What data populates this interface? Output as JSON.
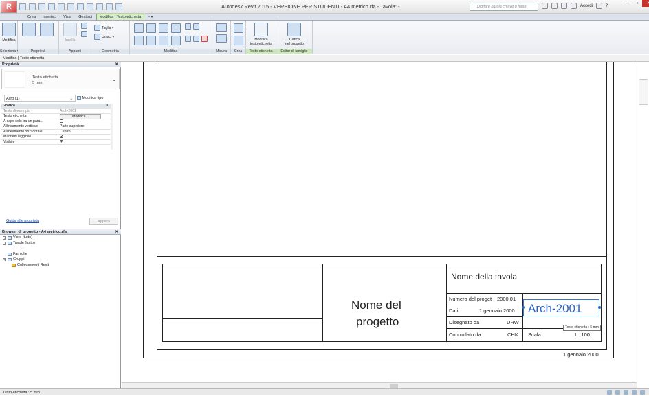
{
  "app": {
    "logo_letter": "R",
    "title": "Autodesk Revit 2015 - VERSIONE PER STUDENTI -    A4 metrico.rfa - Tavola: -",
    "search_placeholder": "Digitare parola chiave o frase",
    "signin_label": "Accedi",
    "help_label": "?"
  },
  "tabs": [
    {
      "label": "Crea",
      "active": false
    },
    {
      "label": "Inserisci",
      "active": false
    },
    {
      "label": "Vista",
      "active": false
    },
    {
      "label": "Gestisci",
      "active": false
    },
    {
      "label": "Modifica | Testo etichetta",
      "active": true
    }
  ],
  "ribbon": {
    "groups": {
      "selection": "Seleziona ▾",
      "properties": "Proprietà",
      "clipboard": "Appunti",
      "geometry": "Geometria",
      "modify": "Modifica",
      "measure": "Misura",
      "create": "Crea",
      "label_text": "Testo etichetta",
      "family_editor": "Editor di famiglie"
    },
    "buttons": {
      "modify": "Modifica",
      "paste": "Incolla",
      "cut": "Taglia ▾",
      "join": "Unisci ▾",
      "edit_label_1": "Modifica",
      "edit_label_2": "testo etichetta",
      "load_project_1": "Carica",
      "load_project_2": "nel progetto"
    }
  },
  "context_bar": "Modifica | Testo etichetta",
  "properties": {
    "title": "Proprietà",
    "type_name": "Testo etichetta",
    "type_size": "5 mm",
    "instance_filter": "Altro (1)",
    "edit_type": "Modifica tipo",
    "rows": [
      {
        "k": "Grafica",
        "v": "",
        "cat": true
      },
      {
        "k": "Testo di esempio",
        "v": "Arch-2001",
        "dim": true
      },
      {
        "k": "Testo etichetta",
        "btn": "Modifica..."
      },
      {
        "k": "A capo solo tra un para...",
        "chk": ""
      },
      {
        "k": "Allineamento verticale",
        "v": "Parte superiore"
      },
      {
        "k": "Allineamento orizzontale",
        "v": "Centro"
      },
      {
        "k": "Mantieni leggibile",
        "chk": "✔"
      },
      {
        "k": "Visibile",
        "chk": "✔"
      }
    ],
    "help_link": "Guida alle proprietà",
    "apply": "Applica"
  },
  "browser": {
    "title": "Browser di progetto - A4 metrico.rfa",
    "items": [
      {
        "label": "Viste (tutto)",
        "indent": 0,
        "box": "-"
      },
      {
        "label": "Tavole (tutto)",
        "indent": 0,
        "box": "-"
      },
      {
        "label": "-",
        "indent": 2,
        "box": ""
      },
      {
        "label": "Famiglie",
        "indent": 0,
        "box": ""
      },
      {
        "label": "Gruppi",
        "indent": 0,
        "box": "+"
      },
      {
        "label": "Collegamenti Revit",
        "indent": 1,
        "box": ""
      }
    ]
  },
  "titleblock": {
    "sheet_name": "Nome della tavola",
    "project_line1": "Nome del",
    "project_line2": "progetto",
    "project_number_label": "Numero del proget",
    "project_number_value": "2000.01",
    "date_label": "Dati",
    "date_value": "1 gennaio 2000",
    "drawn_by_label": "Disegnato da",
    "drawn_by_value": "DRW",
    "checked_by_label": "Controllato da",
    "checked_by_value": "CHK",
    "scale_label": "Scala",
    "scale_value": "1 : 100",
    "sheet_number": "Arch-2001",
    "footer_date": "1 gennaio 2000"
  },
  "tooltip": "Testo etichetta : 5 mm",
  "status_bar": "Testo etichetta : 5 mm"
}
